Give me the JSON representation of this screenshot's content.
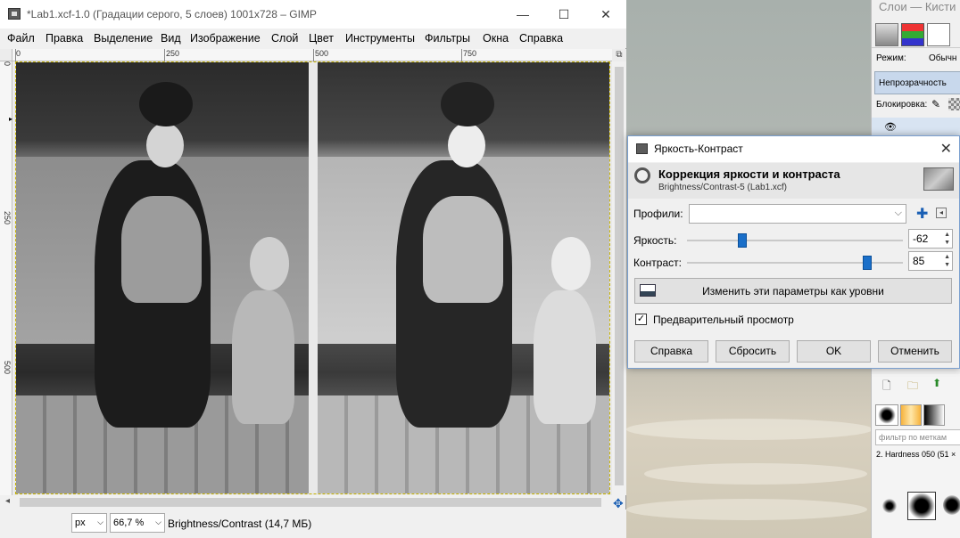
{
  "window": {
    "title": "*Lab1.xcf-1.0 (Градации серого, 5 слоев) 1001x728 – GIMP",
    "minimize": "—",
    "maximize": "☐",
    "close": "✕"
  },
  "menu": [
    "Файл",
    "Правка",
    "Выделение",
    "Вид",
    "Изображение",
    "Слой",
    "Цвет",
    "Инструменты",
    "Фильтры",
    "Окна",
    "Справка"
  ],
  "rulers": {
    "top": [
      "0",
      "250",
      "500",
      "750"
    ],
    "left": [
      "0",
      "250",
      "500"
    ]
  },
  "statusbar": {
    "unit": "px",
    "zoom": "66,7 %",
    "message": "Brightness/Contrast (14,7 МБ)"
  },
  "dock": {
    "title": "Слои — Кисти",
    "mode_label": "Режим:",
    "mode_value": "Обычн",
    "opacity_label": "Непрозрачность",
    "lock_label": "Блокировка:",
    "brush_filter_placeholder": "фильтр по меткам",
    "brush_name": "2. Hardness 050 (51 ×"
  },
  "dialog": {
    "title": "Яркость-Контраст",
    "heading": "Коррекция яркости и контраста",
    "subheading": "Brightness/Contrast-5 (Lab1.xcf)",
    "profiles_label": "Профили:",
    "profiles_value": "",
    "brightness_label": "Яркость:",
    "brightness_value": "-62",
    "brightness": {
      "value": -62,
      "min": -127,
      "max": 127
    },
    "contrast_label": "Контраст:",
    "contrast_value": "85",
    "contrast": {
      "value": 85,
      "min": -127,
      "max": 127
    },
    "levels_button": "Изменить эти параметры как уровни",
    "preview_label": "Предварительный просмотр",
    "preview_checked": true,
    "buttons": [
      "Справка",
      "Сбросить",
      "OK",
      "Отменить"
    ]
  },
  "colors": {
    "accent": "#1a6fc9",
    "selection_border": "#c8b400"
  }
}
